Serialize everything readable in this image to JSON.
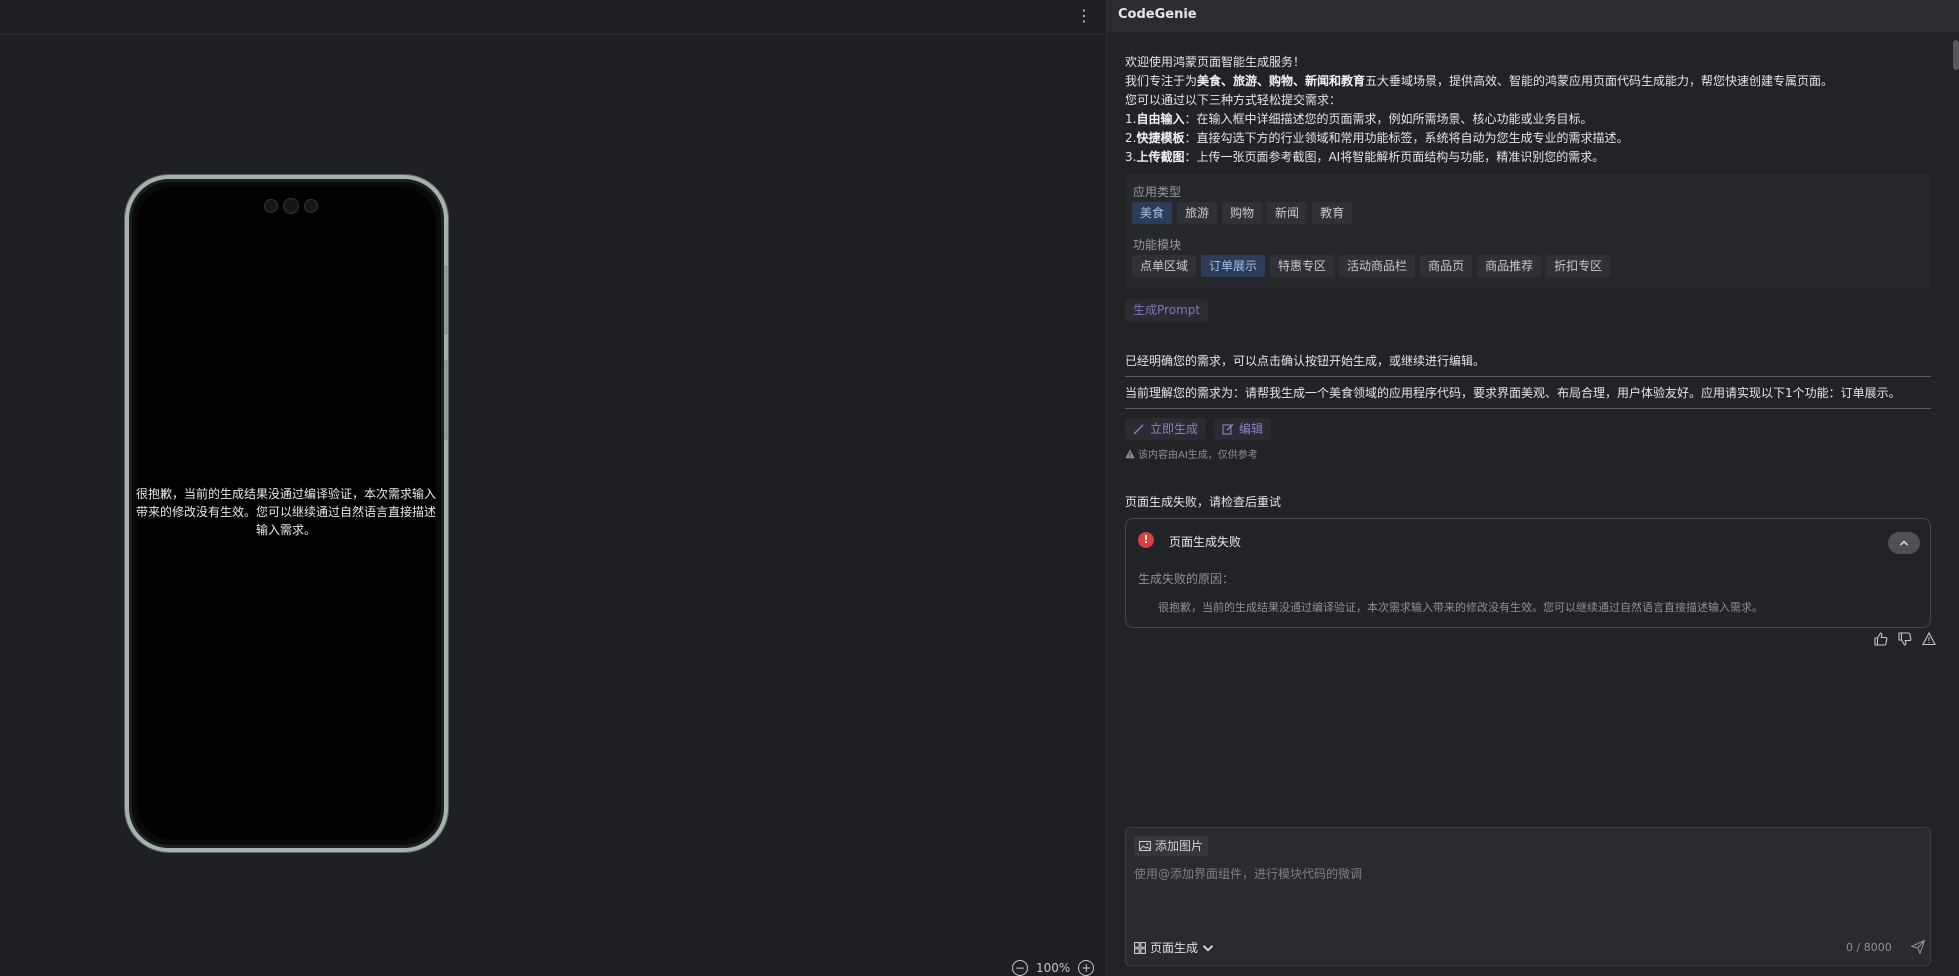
{
  "left": {
    "phone_message": "很抱歉，当前的生成结果没通过编译验证，本次需求输入带来的修改没有生效。您可以继续通过自然语言直接描述输入需求。",
    "zoom_level": "100%",
    "more_icon": "⋮"
  },
  "right": {
    "app_title": "CodeGenie",
    "welcome": {
      "line1": "欢迎使用鸿蒙页面智能生成服务！",
      "line2_pre": "我们专注于为",
      "line2_bold": "美食、旅游、购物、新闻和教育",
      "line2_post": "五大垂域场景，提供高效、智能的鸿蒙应用页面代码生成能力，帮您快速创建专属页面。",
      "line3": "您可以通过以下三种方式轻松提交需求：",
      "item1_num": "1.",
      "item1_bold": "自由输入",
      "item1_text": "：在输入框中详细描述您的页面需求，例如所需场景、核心功能或业务目标。",
      "item2_num": "2.",
      "item2_bold": "快捷模板",
      "item2_text": "：直接勾选下方的行业领域和常用功能标签，系统将自动为您生成专业的需求描述。",
      "item3_num": "3.",
      "item3_bold": "上传截图",
      "item3_text": "：上传一张页面参考截图，AI将智能解析页面结构与功能，精准识别您的需求。"
    },
    "app_type": {
      "label": "应用类型",
      "tags": [
        "美食",
        "旅游",
        "购物",
        "新闻",
        "教育"
      ],
      "selected": "美食"
    },
    "modules": {
      "label": "功能模块",
      "tags": [
        "点单区域",
        "订单展示",
        "特惠专区",
        "活动商品栏",
        "商品页",
        "商品推荐",
        "折扣专区"
      ],
      "selected": "订单展示"
    },
    "generate_prompt_label": "生成Prompt",
    "confirm_text": "已经明确您的需求，可以点击确认按钮开始生成，或继续进行编辑。",
    "understanding_text": "当前理解您的需求为：请帮我生成一个美食领域的应用程序代码，要求界面美观、布局合理，用户体验友好。应用请实现以下1个功能：订单展示。",
    "generate_now_label": "立即生成",
    "edit_label": "编辑",
    "ai_note": "该内容由AI生成，仅供参考",
    "fail_heading": "页面生成失败，请检查后重试",
    "fail_card": {
      "title": "页面生成失败",
      "reason_label": "生成失败的原因：",
      "reason_text": "很抱歉，当前的生成结果没通过编译验证，本次需求输入带来的修改没有生效。您可以继续通过自然语言直接描述输入需求。",
      "icon": "!"
    },
    "input": {
      "add_image_label": "添加图片",
      "placeholder": "使用@添加界面组件，进行模块代码的微调",
      "value": "",
      "mode_label": "页面生成",
      "char_count": "0 / 8000"
    },
    "colors": {
      "accent_purple": "#8b82c4",
      "selected_tag_bg": "#2d3c58",
      "error_red": "#d94141"
    }
  }
}
